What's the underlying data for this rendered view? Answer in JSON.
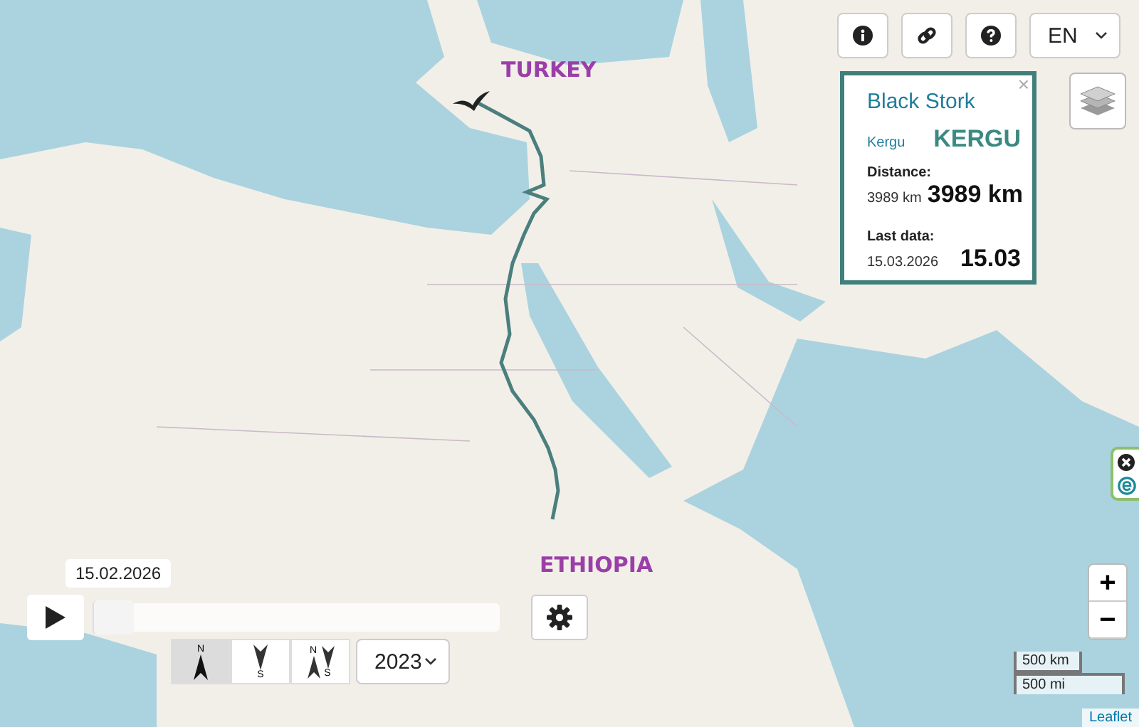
{
  "toolbar": {
    "buttons": [
      {
        "kind": "info"
      },
      {
        "kind": "link"
      },
      {
        "kind": "help"
      }
    ],
    "language": {
      "value": "EN"
    }
  },
  "layers_button": {
    "kind": "layers"
  },
  "popup": {
    "close": "×",
    "title": "Black Stork",
    "name": "Kergu",
    "name_large": "KERGU",
    "distance_label": "Distance:",
    "distance": "3989 km",
    "distance_large": "3989 km",
    "last_data_label": "Last data:",
    "last_data": "15.03.2026",
    "last_data_large": "15.03"
  },
  "country_labels": [
    {
      "text": "TURKEY"
    },
    {
      "text": "ETHIOPIA"
    }
  ],
  "timeline": {
    "date": "15.02.2026",
    "level": 0.0
  },
  "direction_buttons": [
    {
      "kind": "north",
      "selected": true,
      "labels": [
        "N"
      ]
    },
    {
      "kind": "south",
      "selected": false,
      "labels": [
        "S"
      ]
    },
    {
      "kind": "both",
      "selected": false,
      "labels": [
        "N",
        "S"
      ]
    }
  ],
  "year_select": {
    "value": "2023"
  },
  "zoom": {
    "in": "+",
    "out": "−"
  },
  "scale": {
    "metric": "500 km",
    "imperial": "500 mi"
  },
  "attribution": "Leaflet"
}
